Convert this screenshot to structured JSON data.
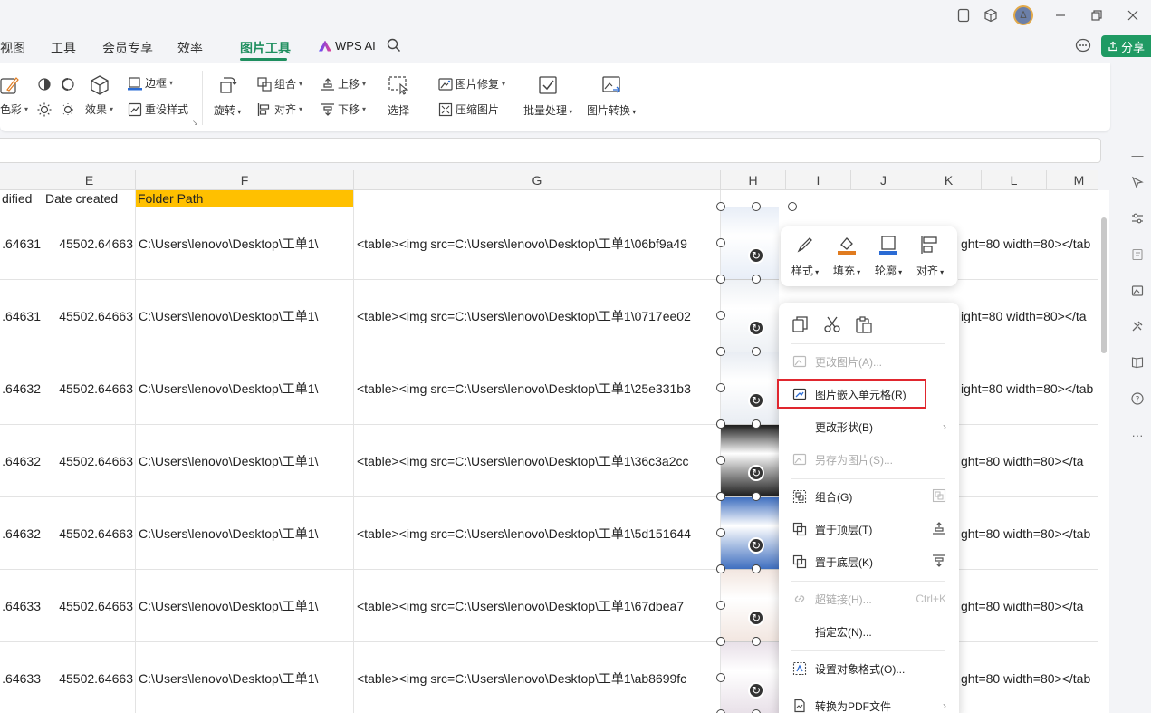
{
  "titlebar": {
    "avatar_initial": "∆"
  },
  "menu": {
    "tabs": [
      {
        "label": "视图"
      },
      {
        "label": "工具"
      },
      {
        "label": "会员专享"
      },
      {
        "label": "效率"
      },
      {
        "label": "图片工具",
        "active": true
      }
    ],
    "wps_ai": "WPS AI",
    "share": "分享"
  },
  "ribbon": {
    "color_partial": "色彩",
    "effect": "效果",
    "border": "边框",
    "reset_style": "重设样式",
    "rotate": "旋转",
    "group": "组合",
    "align": "对齐",
    "move_up": "上移",
    "move_down": "下移",
    "select": "选择",
    "image_repair": "图片修复",
    "compress": "压缩图片",
    "batch": "批量处理",
    "convert": "图片转换"
  },
  "sheet": {
    "columns": [
      "E",
      "F",
      "G",
      "H",
      "I",
      "J",
      "K",
      "L",
      "M"
    ],
    "header_row": {
      "d": "dified",
      "e": "Date created",
      "f": "Folder Path"
    },
    "rows": [
      {
        "d": ".64631",
        "e": "45502.64663",
        "f": "C:\\Users\\lenovo\\Desktop\\工单1\\",
        "g": "<table><img src=C:\\Users\\lenovo\\Desktop\\工单1\\06bf9a49",
        "k": "ght=80 width=80></tab"
      },
      {
        "d": ".64631",
        "e": "45502.64663",
        "f": "C:\\Users\\lenovo\\Desktop\\工单1\\",
        "g": "<table><img src=C:\\Users\\lenovo\\Desktop\\工单1\\0717ee02",
        "k": "ight=80 width=80></ta"
      },
      {
        "d": ".64632",
        "e": "45502.64663",
        "f": "C:\\Users\\lenovo\\Desktop\\工单1\\",
        "g": "<table><img src=C:\\Users\\lenovo\\Desktop\\工单1\\25e331b3",
        "k": "ight=80 width=80></tab"
      },
      {
        "d": ".64632",
        "e": "45502.64663",
        "f": "C:\\Users\\lenovo\\Desktop\\工单1\\",
        "g": "<table><img src=C:\\Users\\lenovo\\Desktop\\工单1\\36c3a2cc",
        "k": "ght=80 width=80></ta"
      },
      {
        "d": ".64632",
        "e": "45502.64663",
        "f": "C:\\Users\\lenovo\\Desktop\\工单1\\",
        "g": "<table><img src=C:\\Users\\lenovo\\Desktop\\工单1\\5d151644",
        "k": "ght=80 width=80></tab"
      },
      {
        "d": ".64633",
        "e": "45502.64663",
        "f": "C:\\Users\\lenovo\\Desktop\\工单1\\",
        "g": "<table><img src=C:\\Users\\lenovo\\Desktop\\工单1\\67dbea7",
        "k": "ght=80 width=80></ta"
      },
      {
        "d": ".64633",
        "e": "45502.64663",
        "f": "C:\\Users\\lenovo\\Desktop\\工单1\\",
        "g": "<table><img src=C:\\Users\\lenovo\\Desktop\\工单1\\ab8699fc",
        "k": "ght=80 width=80></tab"
      }
    ]
  },
  "mini_toolbar": {
    "style": "样式",
    "fill": "填充",
    "outline": "轮廓",
    "align": "对齐"
  },
  "context_menu": {
    "change_picture": "更改图片(A)...",
    "embed_in_cell": "图片嵌入单元格(R)",
    "change_shape": "更改形状(B)",
    "save_as_picture": "另存为图片(S)...",
    "group": "组合(G)",
    "bring_to_top": "置于顶层(T)",
    "send_to_bottom": "置于底层(K)",
    "hyperlink": "超链接(H)...",
    "hyperlink_shortcut": "Ctrl+K",
    "assign_macro": "指定宏(N)...",
    "format_object": "设置对象格式(O)...",
    "convert_pdf": "转换为PDF文件"
  },
  "colors": {
    "accent": "#1f8f5f",
    "share_bg": "#1f9a63",
    "header_highlight": "#ffc000",
    "callout_red": "#e0262e"
  }
}
